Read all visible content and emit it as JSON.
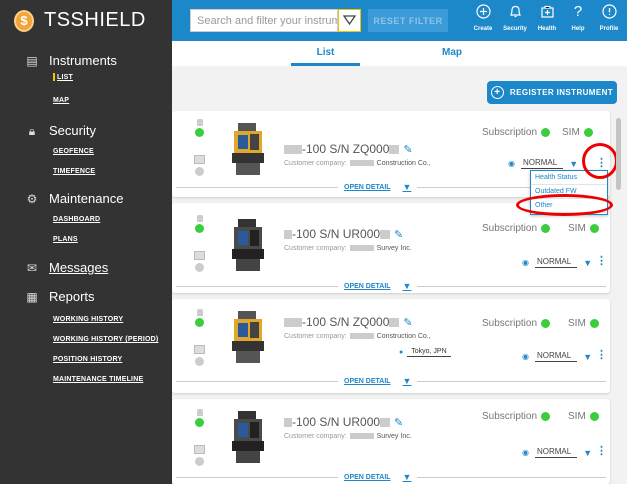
{
  "app": {
    "name": "TSSHIELD"
  },
  "search": {
    "placeholder": "Search and filter your instruments"
  },
  "toolbar": {
    "reset_label": "RESET FILTER"
  },
  "topnav": [
    {
      "label": "Create",
      "icon": "plus-circle-icon"
    },
    {
      "label": "Security",
      "icon": "bell-icon"
    },
    {
      "label": "Health",
      "icon": "health-icon"
    },
    {
      "label": "Help",
      "icon": "help-icon"
    },
    {
      "label": "Profile",
      "icon": "profile-icon"
    }
  ],
  "sidebar": {
    "sections": [
      {
        "label": "Instruments",
        "icon": "instruments-icon",
        "items": [
          "LIST",
          "MAP"
        ]
      },
      {
        "label": "Security",
        "icon": "lock-icon",
        "items": [
          "GEOFENCE",
          "TIMEFENCE"
        ]
      },
      {
        "label": "Maintenance",
        "icon": "gear-icon",
        "items": [
          "DASHBOARD",
          "PLANS"
        ]
      },
      {
        "label": "Messages",
        "icon": "envelope-icon",
        "items": []
      },
      {
        "label": "Reports",
        "icon": "document-icon",
        "items": [
          "WORKING HISTORY",
          "WORKING HISTORY (PERIOD)",
          "POSITION HISTORY",
          "MAINTENANCE TIMELINE"
        ]
      }
    ],
    "active_item": "LIST"
  },
  "tabs": [
    "List",
    "Map"
  ],
  "active_tab": "List",
  "register_label": "REGISTER INSTRUMENT",
  "cards": [
    {
      "title_prefix": "",
      "title_suffix": "-100 S/N ZQ000",
      "company_label": "Customer company:",
      "company": "Construction Co.,",
      "subscription_label": "Subscription",
      "sim_label": "SIM",
      "status": "NORMAL",
      "location": "",
      "open_label": "OPEN DETAIL",
      "device_color": "yellow"
    },
    {
      "title_prefix": "",
      "title_suffix": "-100 S/N UR000",
      "company_label": "Customer company:",
      "company": "Survey Inc.",
      "subscription_label": "Subscription",
      "sim_label": "SIM",
      "status": "NORMAL",
      "location": "",
      "open_label": "OPEN DETAIL",
      "device_color": "grey"
    },
    {
      "title_prefix": "",
      "title_suffix": "-100 S/N ZQ000",
      "company_label": "Customer company:",
      "company": "Construction Co.,",
      "subscription_label": "Subscription",
      "sim_label": "SIM",
      "status": "NORMAL",
      "location": "Tokyo, JPN",
      "open_label": "OPEN DETAIL",
      "device_color": "yellow"
    },
    {
      "title_prefix": "",
      "title_suffix": "-100 S/N UR000",
      "company_label": "Customer company:",
      "company": "Survey Inc.",
      "subscription_label": "Subscription",
      "sim_label": "SIM",
      "status": "NORMAL",
      "location": "",
      "open_label": "OPEN DETAIL",
      "device_color": "grey"
    }
  ],
  "context_menu": [
    "Health Status",
    "Outdated FW",
    "Other"
  ],
  "colors": {
    "primary": "#1c87c9",
    "sidebar": "#333333",
    "status_ok": "#3ccc3c",
    "highlight": "#e00000",
    "filter_accent": "#f5c400"
  }
}
